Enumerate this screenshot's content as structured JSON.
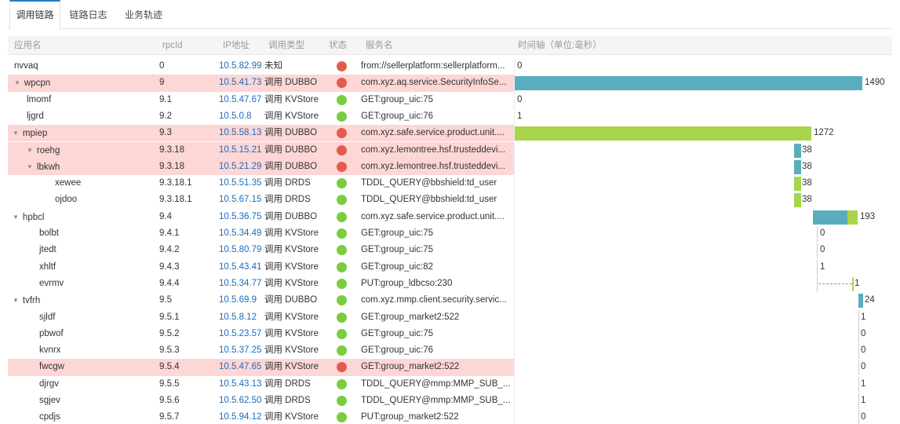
{
  "tabs": [
    "调用链路",
    "链路日志",
    "业务轨迹"
  ],
  "header": {
    "app": "应用名",
    "rpcid": "rpcId",
    "ip": "IP地址",
    "type": "调用类型",
    "status": "状态",
    "service": "服务名",
    "timeline": "时间轴（单位:毫秒）"
  },
  "colors": {
    "accent": "#1e7ac3",
    "error_row": "#fdd6d6",
    "status_ok": "#7bcc3e",
    "status_error": "#e25c4e",
    "bar_teal": "#5aacbf",
    "bar_green": "#a8d54b"
  },
  "rows": [
    {
      "name": "nvvaq",
      "level": 0,
      "caret": false,
      "rpcid": "0",
      "ip": "10.5.82.99",
      "type": "未知",
      "status": "error",
      "service": "from://sellerplatform:sellerplatform...",
      "error": false,
      "duration": "0"
    },
    {
      "name": "wpcpn",
      "level": 0,
      "caret": true,
      "rpcid": "9",
      "ip": "10.5.41.73",
      "type": "调用 DUBBO",
      "status": "error",
      "service": "com.xyz.aq.service.SecurityInfoSe...",
      "error": true,
      "duration": "1490"
    },
    {
      "name": "lmomf",
      "level": 1,
      "caret": false,
      "rpcid": "9.1",
      "ip": "10.5.47.67",
      "type": "调用 KVStore",
      "status": "ok",
      "service": "GET:group_uic:75",
      "error": false,
      "duration": "0"
    },
    {
      "name": "ljgrd",
      "level": 1,
      "caret": false,
      "rpcid": "9.2",
      "ip": "10.5.0.8",
      "type": "调用 KVStore",
      "status": "ok",
      "service": "GET:group_uic:76",
      "error": false,
      "duration": "1"
    },
    {
      "name": "mpiep",
      "level": 1,
      "caret": true,
      "rpcid": "9.3",
      "ip": "10.5.58.13",
      "type": "调用 DUBBO",
      "status": "error",
      "service": "com.xyz.safe.service.product.unit....",
      "error": true,
      "duration": "1272"
    },
    {
      "name": "roehg",
      "level": 2,
      "caret": true,
      "rpcid": "9.3.18",
      "ip": "10.5.15.21",
      "type": "调用 DUBBO",
      "status": "error",
      "service": "com.xyz.lemontree.hsf.trusteddevi...",
      "error": true,
      "duration": "38"
    },
    {
      "name": "lbkwh",
      "level": 2,
      "caret": true,
      "rpcid": "9.3.18",
      "ip": "10.5.21.29",
      "type": "调用 DUBBO",
      "status": "error",
      "service": "com.xyz.lemontree.hsf.trusteddevi...",
      "error": true,
      "duration": "38"
    },
    {
      "name": "xewee",
      "level": 3,
      "caret": false,
      "rpcid": "9.3.18.1",
      "ip": "10.5.51.35",
      "type": "调用 DRDS",
      "status": "ok",
      "service": "TDDL_QUERY@bbshield:td_user",
      "error": false,
      "duration": "38"
    },
    {
      "name": "ojdoo",
      "level": 3,
      "caret": false,
      "rpcid": "9.3.18.1",
      "ip": "10.5.67.15",
      "type": "调用 DRDS",
      "status": "ok",
      "service": "TDDL_QUERY@bbshield:td_user",
      "error": false,
      "duration": "38"
    },
    {
      "name": "hpbcl",
      "level": 1,
      "caret": true,
      "rpcid": "9.4",
      "ip": "10.5.36.75",
      "type": "调用 DUBBO",
      "status": "ok",
      "service": "com.xyz.safe.service.product.unit....",
      "error": false,
      "duration": "193"
    },
    {
      "name": "bolbt",
      "level": 2,
      "caret": false,
      "rpcid": "9.4.1",
      "ip": "10.5.34.49",
      "type": "调用 KVStore",
      "status": "ok",
      "service": "GET:group_uic:75",
      "error": false,
      "duration": "0"
    },
    {
      "name": "jtedt",
      "level": 2,
      "caret": false,
      "rpcid": "9.4.2",
      "ip": "10.5.80.79",
      "type": "调用 KVStore",
      "status": "ok",
      "service": "GET:group_uic:75",
      "error": false,
      "duration": "0"
    },
    {
      "name": "xhltf",
      "level": 2,
      "caret": false,
      "rpcid": "9.4.3",
      "ip": "10.5.43.41",
      "type": "调用 KVStore",
      "status": "ok",
      "service": "GET:group_uic:82",
      "error": false,
      "duration": "1"
    },
    {
      "name": "evrmv",
      "level": 2,
      "caret": false,
      "rpcid": "9.4.4",
      "ip": "10.5.34.77",
      "type": "调用 KVStore",
      "status": "ok",
      "service": "PUT:group_ldbcso:230",
      "error": false,
      "duration": "1"
    },
    {
      "name": "tvfrh",
      "level": 1,
      "caret": true,
      "rpcid": "9.5",
      "ip": "10.5.69.9",
      "type": "调用 DUBBO",
      "status": "ok",
      "service": "com.xyz.mmp.client.security.servic...",
      "error": false,
      "duration": "24"
    },
    {
      "name": "sjldf",
      "level": 2,
      "caret": false,
      "rpcid": "9.5.1",
      "ip": "10.5.8.12",
      "type": "调用 KVStore",
      "status": "ok",
      "service": "GET:group_market2:522",
      "error": false,
      "duration": "1"
    },
    {
      "name": "pbwof",
      "level": 2,
      "caret": false,
      "rpcid": "9.5.2",
      "ip": "10.5.23.57",
      "type": "调用 KVStore",
      "status": "ok",
      "service": "GET:group_uic:75",
      "error": false,
      "duration": "0"
    },
    {
      "name": "kvnrx",
      "level": 2,
      "caret": false,
      "rpcid": "9.5.3",
      "ip": "10.5.37.25",
      "type": "调用 KVStore",
      "status": "ok",
      "service": "GET:group_uic:76",
      "error": false,
      "duration": "0"
    },
    {
      "name": "fwcgw",
      "level": 2,
      "caret": false,
      "rpcid": "9.5.4",
      "ip": "10.5.47.65",
      "type": "调用 KVStore",
      "status": "error",
      "service": "GET:group_market2:522",
      "error": true,
      "duration": "0"
    },
    {
      "name": "djrgv",
      "level": 2,
      "caret": false,
      "rpcid": "9.5.5",
      "ip": "10.5.43.13",
      "type": "调用 DRDS",
      "status": "ok",
      "service": "TDDL_QUERY@mmp:MMP_SUB_...",
      "error": false,
      "duration": "1"
    },
    {
      "name": "sgjev",
      "level": 2,
      "caret": false,
      "rpcid": "9.5.6",
      "ip": "10.5.62.50",
      "type": "调用 DRDS",
      "status": "ok",
      "service": "TDDL_QUERY@mmp:MMP_SUB_...",
      "error": false,
      "duration": "1"
    },
    {
      "name": "cpdjs",
      "level": 2,
      "caret": false,
      "rpcid": "9.5.7",
      "ip": "10.5.94.12",
      "type": "调用 KVStore",
      "status": "ok",
      "service": "PUT:group_market2:522",
      "error": false,
      "duration": "0"
    }
  ]
}
